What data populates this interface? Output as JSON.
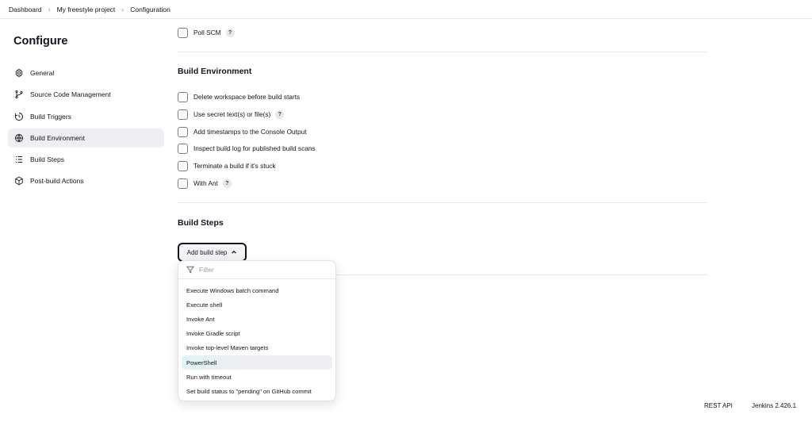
{
  "breadcrumb": [
    "Dashboard",
    "My freestyle project",
    "Configuration"
  ],
  "page_title": "Configure",
  "sidebar": {
    "items": [
      {
        "label": "General",
        "icon": "gear-icon",
        "active": false
      },
      {
        "label": "Source Code Management",
        "icon": "branch-icon",
        "active": false
      },
      {
        "label": "Build Triggers",
        "icon": "clock-icon",
        "active": false
      },
      {
        "label": "Build Environment",
        "icon": "globe-icon",
        "active": true
      },
      {
        "label": "Build Steps",
        "icon": "list-icon",
        "active": false
      },
      {
        "label": "Post-build Actions",
        "icon": "box-icon",
        "active": false
      }
    ]
  },
  "triggers": {
    "poll_scm": {
      "label": "Poll SCM",
      "checked": false
    }
  },
  "build_environment": {
    "title": "Build Environment",
    "options": [
      {
        "label": "Delete workspace before build starts",
        "help": false,
        "checked": false
      },
      {
        "label": "Use secret text(s) or file(s)",
        "help": true,
        "checked": false
      },
      {
        "label": "Add timestamps to the Console Output",
        "help": false,
        "checked": false
      },
      {
        "label": "Inspect build log for published build scans",
        "help": false,
        "checked": false
      },
      {
        "label": "Terminate a build if it's stuck",
        "help": false,
        "checked": false
      },
      {
        "label": "With Ant",
        "help": true,
        "checked": false
      }
    ]
  },
  "build_steps": {
    "title": "Build Steps",
    "add_button": "Add build step",
    "dropdown": {
      "filter_placeholder": "Filter",
      "items": [
        "Execute Windows batch command",
        "Execute shell",
        "Invoke Ant",
        "Invoke Gradle script",
        "Invoke top-level Maven targets",
        "PowerShell",
        "Run with timeout",
        "Set build status to \"pending\" on GitHub commit"
      ],
      "highlighted": "PowerShell"
    }
  },
  "help_symbol": "?",
  "footer": {
    "rest_api": "REST API",
    "version": "Jenkins 2.426.1"
  }
}
